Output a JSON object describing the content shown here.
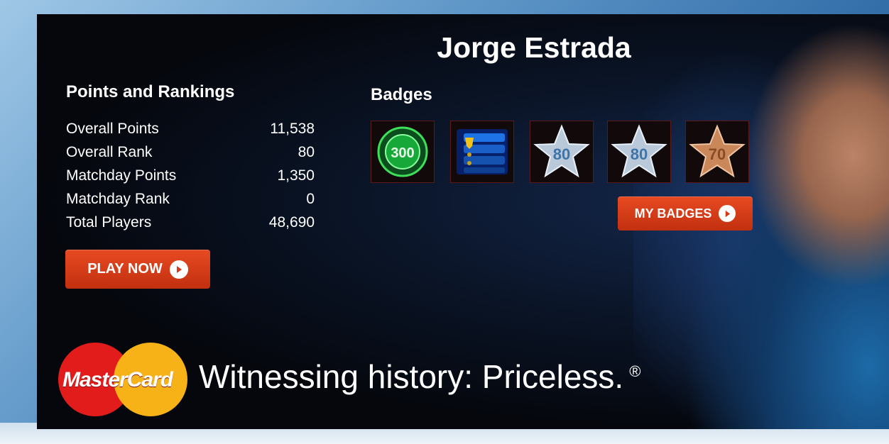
{
  "profile": {
    "player_name": "Jorge Estrada"
  },
  "points_section": {
    "title": "Points and Rankings",
    "rows": [
      {
        "label": "Overall Points",
        "value": "11,538"
      },
      {
        "label": "Overall Rank",
        "value": "80"
      },
      {
        "label": "Matchday Points",
        "value": "1,350"
      },
      {
        "label": "Matchday Rank",
        "value": "0"
      },
      {
        "label": "Total Players",
        "value": "48,690"
      }
    ],
    "play_button": "PLAY NOW"
  },
  "badges_section": {
    "title": "Badges",
    "badges": [
      {
        "icon": "green-300-medal-icon",
        "label": "300"
      },
      {
        "icon": "shield-levels-icon",
        "label": ""
      },
      {
        "icon": "silver-star-icon",
        "label": "80"
      },
      {
        "icon": "silver-star-icon",
        "label": "80"
      },
      {
        "icon": "bronze-star-icon",
        "label": "70"
      }
    ],
    "my_badges_button": "MY BADGES"
  },
  "sponsor": {
    "logo_text": "MasterCard",
    "tagline": "Witnessing history: Priceless.",
    "registered_mark": "®"
  },
  "colors": {
    "accent_button": "#d63a16",
    "panel_background": "#05070d",
    "text": "#ffffff"
  }
}
